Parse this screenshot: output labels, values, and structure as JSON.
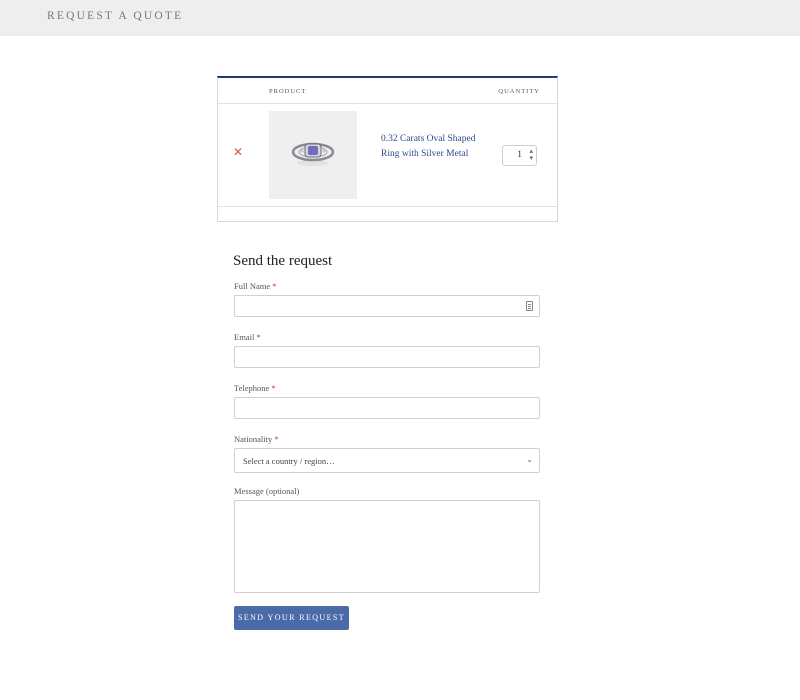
{
  "header": {
    "title": "REQUEST A QUOTE"
  },
  "table": {
    "columns": {
      "product": "PRODUCT",
      "quantity": "QUANTITY"
    },
    "items": [
      {
        "remove_icon": "close-icon",
        "name": "0.32 Carats Oval Shaped Ring with Silver Metal",
        "quantity": "1"
      }
    ]
  },
  "form": {
    "title": "Send the request",
    "required_mark": "*",
    "full_name": {
      "label": "Full Name",
      "value": ""
    },
    "email": {
      "label": "Email",
      "value": ""
    },
    "telephone": {
      "label": "Telephone",
      "value": ""
    },
    "nationality": {
      "label": "Nationality",
      "selected": "Select a country / region…"
    },
    "message": {
      "label": "Message (optional)",
      "value": ""
    },
    "submit_label": "SEND YOUR REQUEST"
  },
  "colors": {
    "accent": "#4a6aa8",
    "table_border": "#1f3d73",
    "link": "#2b4a8a",
    "remove": "#d9534f"
  }
}
